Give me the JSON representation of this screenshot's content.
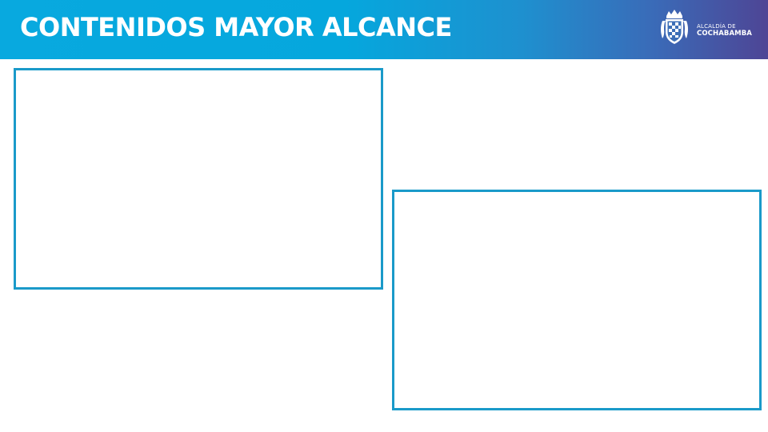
{
  "slide": {
    "title": "CONTENIDOS MAYOR ALCANCE"
  },
  "logo": {
    "line1": "ALCALDÍA DE",
    "line2": "COCHABAMBA",
    "icon": "coat-of-arms-icon"
  },
  "colors": {
    "header_gradient_start": "#08a9df",
    "header_gradient_end": "#4e4595",
    "frame_border": "#1a9ac9",
    "title_text": "#ffffff"
  }
}
